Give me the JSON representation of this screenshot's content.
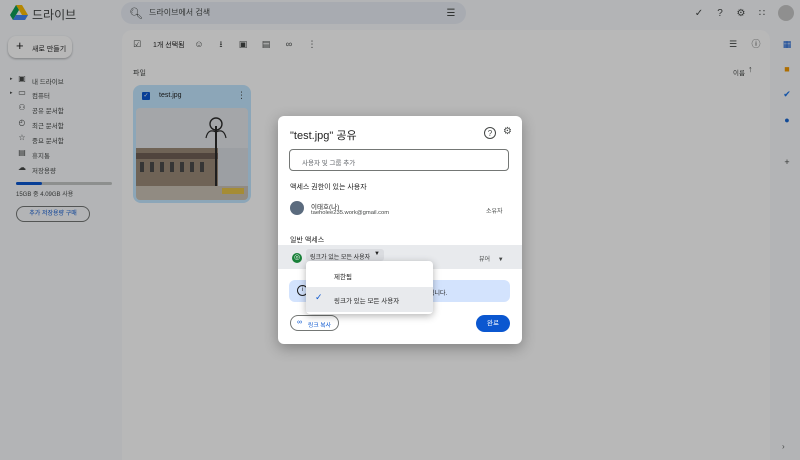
{
  "app": {
    "title": "드라이브"
  },
  "search": {
    "placeholder": "드라이브에서 검색"
  },
  "header_icons": [
    "done-icon",
    "help-icon",
    "settings-icon",
    "apps-grid-icon"
  ],
  "sidebar": {
    "new_label": "새로 만들기",
    "items": [
      {
        "label": "내 드라이브",
        "icon": "drive-icon",
        "expandable": true
      },
      {
        "label": "컴퓨터",
        "icon": "computer-icon",
        "expandable": true
      },
      {
        "label": "공유 문서함",
        "icon": "shared-icon",
        "expandable": false
      },
      {
        "label": "최근 문서함",
        "icon": "clock-icon",
        "expandable": false
      },
      {
        "label": "중요 문서함",
        "icon": "star-icon",
        "expandable": false
      },
      {
        "label": "휴지통",
        "icon": "trash-icon",
        "expandable": false
      },
      {
        "label": "저장용량",
        "icon": "cloud-icon",
        "expandable": false
      }
    ],
    "storage_text": "15GB 중 4.09GB 사용",
    "storage_fraction": 0.27,
    "buy_storage_label": "추가 저장용량 구매"
  },
  "action_bar": {
    "selected_count": "1개 선택됨"
  },
  "files": {
    "section_label": "파일",
    "sort_label": "이름",
    "items": [
      {
        "name": "test.jpg",
        "selected": true
      }
    ]
  },
  "share_dialog": {
    "title": "\"test.jpg\" 공유",
    "add_placeholder": "사용자 및 그룹 추가",
    "access_heading": "액세스 권한이 있는 사용자",
    "user_name": "이태호(나)",
    "user_email": "taeholee235.work@gmail.com",
    "user_role": "소유자",
    "general_heading": "일반 액세스",
    "general_access_value": "링크가 있는 모든 사용자",
    "role_value": "뷰어",
    "info_text": "됩니다.",
    "copy_link_label": "링크 복사",
    "done_label": "완료"
  },
  "access_menu": {
    "options": [
      "제한됨",
      "링크가 있는 모든 사용자"
    ],
    "selected_index": 1
  },
  "colors": {
    "accent": "#0b57d0",
    "selected_card": "#c2e7ff",
    "globe": "#188038"
  }
}
